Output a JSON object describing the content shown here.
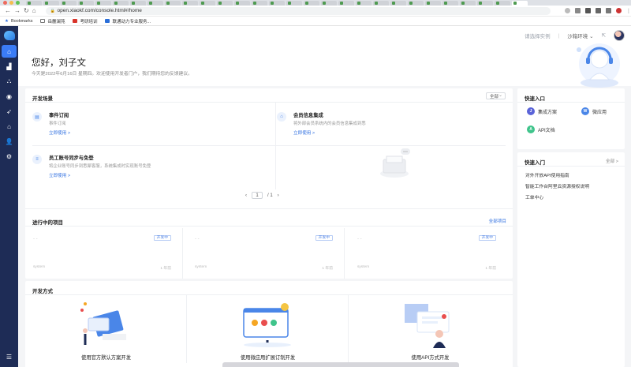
{
  "browser": {
    "url": "open.xiaokf.com/console.html#/home",
    "bookmarks_label": "Bookmarks",
    "bookmarks": [
      "岳麓澜苑",
      "考研培训",
      "联通动力专业服务..."
    ]
  },
  "colors": {
    "accent": "#2f6fe0",
    "sidebar": "#1e2c56",
    "sidebar_active": "#3b7cf6"
  },
  "sidebar": {
    "items": [
      {
        "icon": "home-icon",
        "active": true
      },
      {
        "icon": "app-icon"
      },
      {
        "icon": "org-icon"
      },
      {
        "icon": "chat-icon"
      },
      {
        "icon": "rocket-icon"
      },
      {
        "icon": "store-icon"
      },
      {
        "icon": "user-icon"
      },
      {
        "icon": "gear-icon"
      }
    ],
    "bottom_icon": "menu-icon"
  },
  "topbar": {
    "instance_placeholder": "请选择实例",
    "env_label": "沙箱环境"
  },
  "hero": {
    "greeting": "您好，刘子文",
    "subtitle": "今天是2022年6月16日 星期四。欢迎使用开发者门户，我们期待您的反馈建议。"
  },
  "scenes": {
    "title": "开发场景",
    "filter": "全部",
    "items": [
      {
        "icon": "subscribe-icon",
        "title": "事件订阅",
        "desc": "事件订阅",
        "link": "立即使用 >"
      },
      {
        "icon": "member-icon",
        "title": "会员信息集成",
        "desc": "将外部会员系统内的会员信息集成到悉",
        "link": "立即使用 >"
      },
      {
        "icon": "staff-sync-icon",
        "title": "员工账号同步与免登",
        "desc": "将企业账号同步到悉犀客服，系统集成时实现账号免登",
        "link": "立即使用 >"
      }
    ],
    "pager": {
      "current": "1",
      "total": "/ 1"
    }
  },
  "quick_entry": {
    "title": "快速入口",
    "items": [
      {
        "badge": "J",
        "label": "集成方案",
        "color": "#5a63d8"
      },
      {
        "badge": "W",
        "label": "微应用",
        "color": "#4a86e8"
      },
      {
        "badge": "A",
        "label": "API文档",
        "color": "#3fc48b"
      }
    ]
  },
  "quick_start": {
    "title": "快速入门",
    "more": "全部 >",
    "items": [
      "对外开放API使用指南",
      "智能工作台阿里云资源授权说明",
      "工单中心"
    ]
  },
  "projects": {
    "title": "进行中的项目",
    "all_link": "全部项目",
    "items": [
      {
        "name": "- -",
        "badge": "开发中",
        "meta": "system",
        "date": "1 年前"
      },
      {
        "name": "- -",
        "badge": "开发中",
        "meta": "system",
        "date": "1 年前"
      },
      {
        "name": "- -",
        "badge": "开发中",
        "meta": "system",
        "date": "1 年前"
      }
    ]
  },
  "dev_modes": {
    "title": "开发方式",
    "items": [
      "使用官方默认方案开发",
      "使用微应用扩展订制开发",
      "使用API方式开发"
    ]
  }
}
